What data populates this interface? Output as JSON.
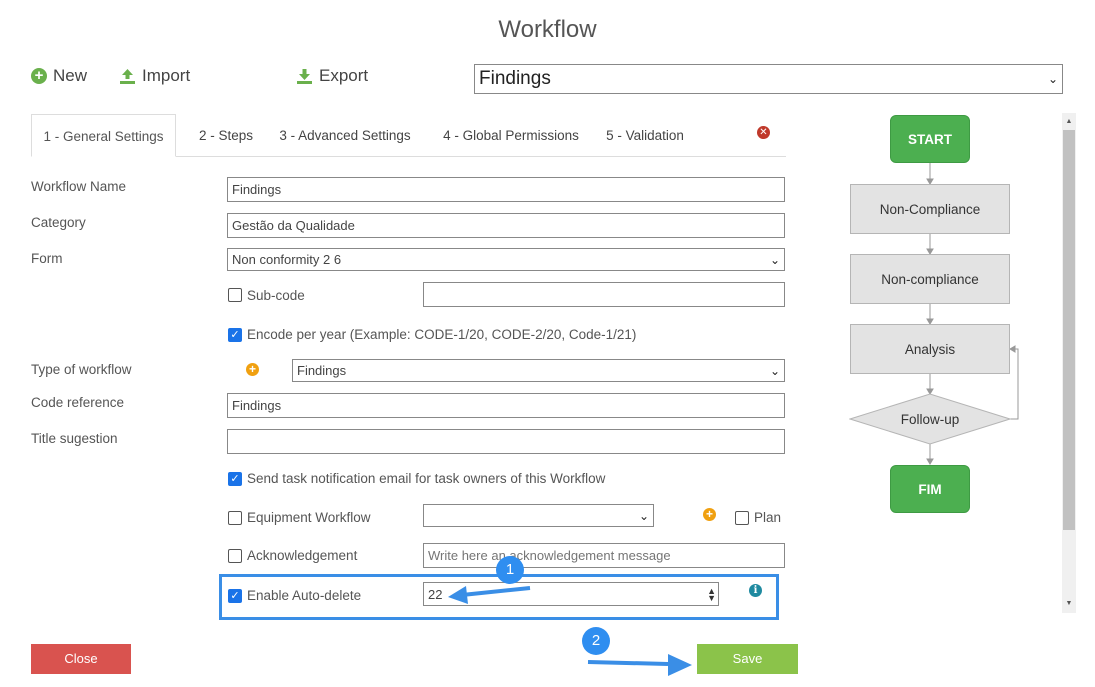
{
  "window": {
    "title": "Workflow"
  },
  "toolbar": {
    "new_label": "New",
    "import_label": "Import",
    "export_label": "Export"
  },
  "workflow_select": {
    "value": "Findings"
  },
  "tabs": [
    {
      "label": "1 - General Settings"
    },
    {
      "label": "2 - Steps"
    },
    {
      "label": "3 - Advanced Settings"
    },
    {
      "label": "4 - Global Permissions"
    },
    {
      "label": "5 - Validation"
    }
  ],
  "form": {
    "workflow_name": {
      "label": "Workflow Name",
      "value": "Findings"
    },
    "category": {
      "label": "Category",
      "value": "Gestão da Qualidade"
    },
    "form": {
      "label": "Form",
      "value": "Non conformity 2 6"
    },
    "sub_code": {
      "label": "Sub-code",
      "value": "",
      "checked": false
    },
    "encode_per_year": {
      "label": "Encode per year (Example: CODE-1/20, CODE-2/20, Code-1/21)",
      "checked": true
    },
    "type_of_workflow": {
      "label": "Type of workflow",
      "value": "Findings"
    },
    "code_reference": {
      "label": "Code reference",
      "value": "Findings"
    },
    "title_suggestion": {
      "label": "Title sugestion",
      "value": ""
    },
    "send_notification": {
      "label": "Send task notification email for task owners of this Workflow",
      "checked": true
    },
    "equipment_workflow": {
      "label": "Equipment Workflow",
      "value": "",
      "checked": false
    },
    "plan": {
      "label": "Plan",
      "checked": false
    },
    "acknowledgement": {
      "label": "Acknowledgement",
      "placeholder": "Write here an acknowledgement message",
      "checked": false
    },
    "auto_delete": {
      "label": "Enable Auto-delete",
      "value": "22",
      "checked": true
    }
  },
  "annotations": {
    "step1": "1",
    "step2": "2"
  },
  "buttons": {
    "close_label": "Close",
    "save_label": "Save"
  },
  "flow": {
    "start": "START",
    "steps": [
      "Non-Compliance",
      "Non-compliance",
      "Analysis"
    ],
    "decision": "Follow-up",
    "end": "FIM"
  },
  "colors": {
    "accent_green": "#4caf50",
    "save_green": "#8bc34a",
    "close_red": "#d9534f",
    "highlight_blue": "#3a8ee6"
  }
}
